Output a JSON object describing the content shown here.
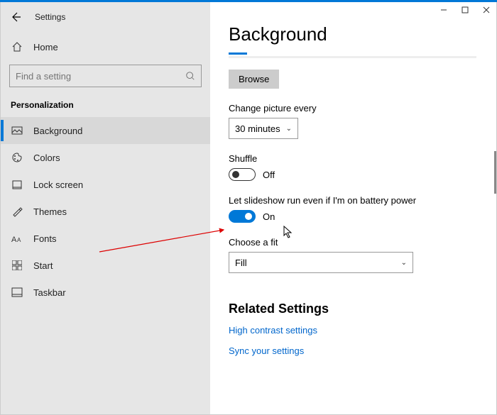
{
  "app": {
    "title": "Settings"
  },
  "sidebar": {
    "home": "Home",
    "search_placeholder": "Find a setting",
    "category": "Personalization",
    "items": [
      {
        "label": "Background"
      },
      {
        "label": "Colors"
      },
      {
        "label": "Lock screen"
      },
      {
        "label": "Themes"
      },
      {
        "label": "Fonts"
      },
      {
        "label": "Start"
      },
      {
        "label": "Taskbar"
      }
    ]
  },
  "content": {
    "title": "Background",
    "browse": "Browse",
    "change_label": "Change picture every",
    "change_value": "30 minutes",
    "shuffle_label": "Shuffle",
    "shuffle_value": "Off",
    "battery_label": "Let slideshow run even if I'm on battery power",
    "battery_value": "On",
    "fit_label": "Choose a fit",
    "fit_value": "Fill",
    "related_heading": "Related Settings",
    "link1": "High contrast settings",
    "link2": "Sync your settings"
  }
}
